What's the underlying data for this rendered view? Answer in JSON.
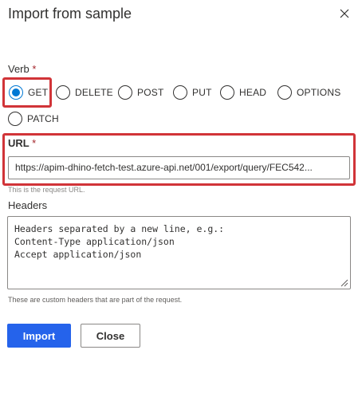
{
  "dialog": {
    "title": "Import from sample",
    "close_icon": "close-icon"
  },
  "verb": {
    "label": "Verb",
    "required_mark": "*",
    "selected": "GET",
    "options": [
      "GET",
      "DELETE",
      "POST",
      "PUT",
      "HEAD",
      "OPTIONS",
      "PATCH"
    ]
  },
  "url": {
    "label": "URL",
    "required_mark": "*",
    "value": "https://apim-dhino-fetch-test.azure-api.net/001/export/query/FEC542...",
    "hint": "This is the request URL."
  },
  "headers": {
    "label": "Headers",
    "placeholder": "Headers separated by a new line, e.g.:\nContent-Type application/json\nAccept application/json",
    "hint": "These are custom headers that are part of the request."
  },
  "buttons": {
    "import_label": "Import",
    "close_label": "Close"
  },
  "colors": {
    "accent": "#0078d4",
    "primary_button": "#2563eb",
    "highlight": "#d13438"
  }
}
